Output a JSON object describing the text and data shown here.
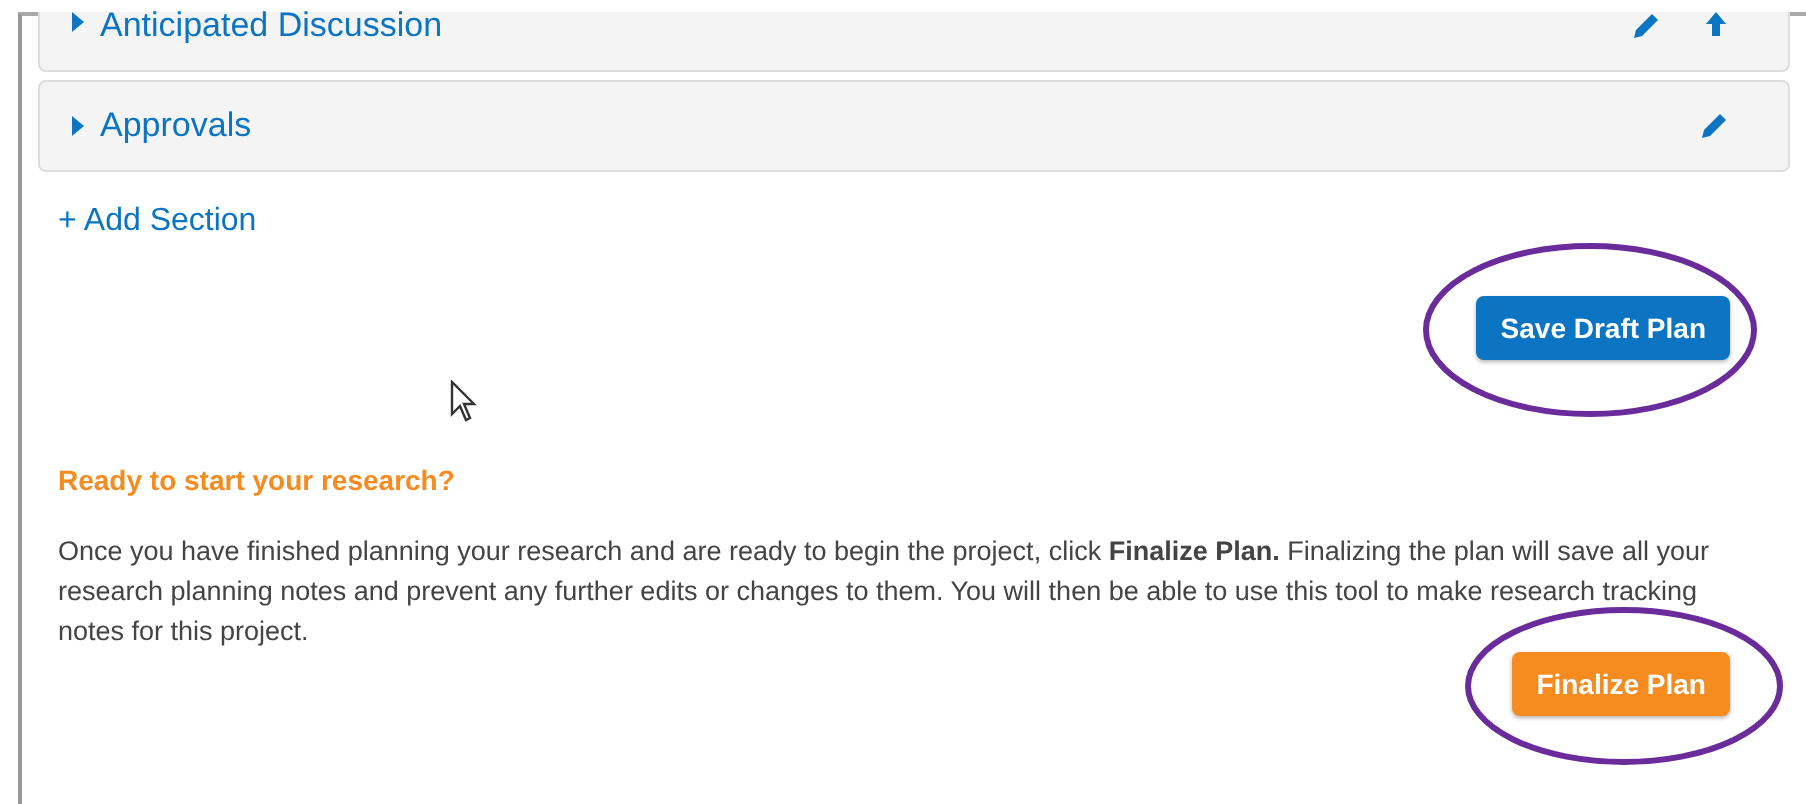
{
  "sections": [
    {
      "title": "Anticipated Discussion",
      "expanded": false,
      "kind": "movable"
    },
    {
      "title": "Approvals",
      "expanded": false,
      "kind": "plain"
    }
  ],
  "add_section": "+ Add Section",
  "save_button": "Save Draft Plan",
  "finalize": {
    "heading": "Ready to start your research?",
    "text": "Once you have finished planning your research and are ready to begin the project, click **Finalize Plan.** Finalizing the plan will save all your research planning notes and prevent any further edits or changes to them. You will then be able to use this tool to make research tracking notes for this project.",
    "button": "Finalize Plan"
  }
}
